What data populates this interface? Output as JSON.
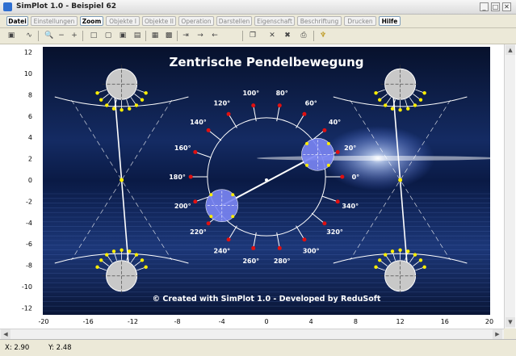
{
  "window": {
    "title": "SimPlot 1.0 - Beispiel 62"
  },
  "menu": [
    "Datei",
    "Einstellungen",
    "Zoom",
    "Objekte I",
    "Objekte II",
    "Operation",
    "Darstellen",
    "Eigenschaft",
    "Beschriftung",
    "Drucken",
    "Hilfe"
  ],
  "menu_active": [
    true,
    false,
    true,
    false,
    false,
    false,
    false,
    false,
    false,
    false,
    true
  ],
  "toolbar_icons": [
    "calculator-icon",
    "curve-icon",
    "zoom-icon",
    "zoom-out-icon",
    "zoom-in-icon",
    "square-icon",
    "box-icon",
    "box2-icon",
    "box3-icon",
    "grid-icon",
    "grid-edit-icon",
    "arrow-in-icon",
    "arrow-right-icon",
    "arrow-left-icon",
    "copy-icon",
    "cross-icon",
    "cross2-icon",
    "print-icon",
    "hint-icon"
  ],
  "toolbar_glyphs": [
    "▣",
    "∿",
    "🔍",
    "−",
    "+",
    "□",
    "▢",
    "▣",
    "▤",
    "▦",
    "▩",
    "⇥",
    "→",
    "←",
    "❐",
    "✕",
    "✖",
    "⎙",
    "♆"
  ],
  "plot": {
    "title": "Zentrische Pendelbewegung",
    "footer": "© Created with SimPlot 1.0 - Developed by ReduSoft",
    "x_ticks": [
      "-20",
      "-16",
      "-12",
      "-8",
      "-4",
      "0",
      "4",
      "8",
      "12",
      "16",
      "20"
    ],
    "y_ticks": [
      "12",
      "10",
      "8",
      "6",
      "4",
      "2",
      "0",
      "-2",
      "-4",
      "-6",
      "-8",
      "-10",
      "-12"
    ],
    "angle_labels": [
      "0°",
      "20°",
      "40°",
      "60°",
      "80°",
      "100°",
      "120°",
      "140°",
      "160°",
      "180°",
      "200°",
      "220°",
      "240°",
      "260°",
      "280°",
      "300°",
      "320°",
      "340°"
    ]
  },
  "status": {
    "x": "X: 2.90",
    "y": "Y: 2.48"
  }
}
